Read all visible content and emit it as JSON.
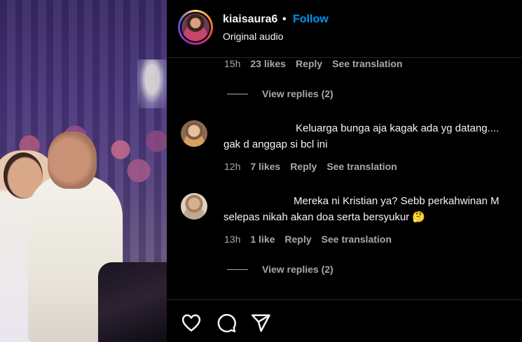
{
  "post": {
    "username": "kiaisaura6",
    "separator": "•",
    "follow_label": "Follow",
    "audio": "Original audio"
  },
  "comments_top": {
    "time": "15h",
    "likes": "23 likes",
    "reply": "Reply",
    "translation": "See translation",
    "view_replies": "View replies (2)"
  },
  "comments": [
    {
      "line1": "Keluarga bunga aja kagak ada yg datang....",
      "line2": "gak d anggap si bcl ini",
      "time": "12h",
      "likes": "7 likes",
      "reply": "Reply",
      "translation": "See translation"
    },
    {
      "line1": "Mereka ni Kristian ya? Sebb perkahwinan M",
      "line2": "selepas nikah akan doa serta bersyukur 🤔",
      "time": "13h",
      "likes": "1 like",
      "reply": "Reply",
      "translation": "See translation",
      "view_replies": "View replies (2)"
    }
  ],
  "actions": {
    "like_icon": "heart-icon",
    "comment_icon": "comment-icon",
    "share_icon": "send-icon"
  },
  "colors": {
    "follow": "#0095f6",
    "meta": "#a8a8a8",
    "background": "#000000"
  }
}
